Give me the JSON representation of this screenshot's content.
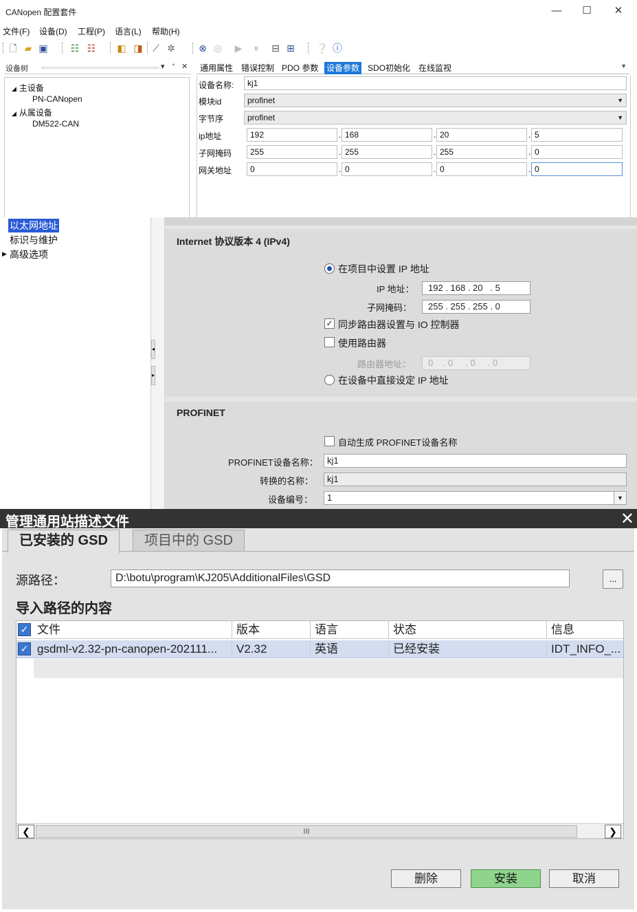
{
  "canopen": {
    "title": "CANopen 配置套件",
    "window_controls": {
      "minimize": "—",
      "maximize": "☐",
      "close": "✕"
    },
    "menu": [
      "文件(F)",
      "设备(D)",
      "工程(P)",
      "语言(L)",
      "帮助(H)"
    ],
    "device_tree": {
      "header": "设备树",
      "header_controls": [
        "▾",
        "ᐩ",
        "✕"
      ],
      "master_group": "主设备",
      "master": "PN-CANopen",
      "slave_group": "从属设备",
      "slave": "DM522-CAN"
    },
    "tabs": [
      "通用属性",
      "错误控制",
      "PDO 参数",
      "设备参数",
      "SDO初始化",
      "在线监视"
    ],
    "active_tab": "设备参数",
    "params": {
      "device_name_label": "设备名称:",
      "device_name": "kj1",
      "module_id_label": "模块id",
      "module_id": "profinet",
      "byte_order_label": "字节序",
      "byte_order": "profinet",
      "ip_label": "ip地址",
      "ip": [
        "192",
        "168",
        "20",
        "5"
      ],
      "subnet_label": "子网掩码",
      "subnet": [
        "255",
        "255",
        "255",
        "0"
      ],
      "gateway_label": "网关地址",
      "gateway": [
        "0",
        "0",
        "0",
        "0"
      ]
    }
  },
  "tia": {
    "nav": [
      "以太网地址",
      "标识与维护",
      "高级选项"
    ],
    "ipv4": {
      "title": "Internet 协议版本 4 (IPv4)",
      "set_in_project": "在项目中设置 IP 地址",
      "ip_label": "IP 地址：",
      "ip": "192 . 168 . 20   . 5",
      "subnet_label": "子网掩码：",
      "subnet": "255 . 255 . 255 . 0",
      "sync_router": "同步路由器设置与 IO 控制器",
      "use_router": "使用路由器",
      "router_label": "路由器地址：",
      "router": "0    . 0     . 0     . 0",
      "set_directly": "在设备中直接设定 IP 地址"
    },
    "profinet": {
      "title": "PROFINET",
      "auto_name": "自动生成 PROFINET设备名称",
      "name_label": "PROFINET设备名称：",
      "name": "kj1",
      "converted_label": "转换的名称：",
      "converted": "kj1",
      "number_label": "设备编号：",
      "number": "1"
    }
  },
  "gsd": {
    "title": "管理通用站描述文件",
    "close": "✕",
    "tabs": [
      "已安装的 GSD",
      "项目中的 GSD"
    ],
    "source_label": "源路径：",
    "source_path": "D:\\botu\\program\\KJ205\\AdditionalFiles\\GSD",
    "browse": "...",
    "section_title": "导入路径的内容",
    "columns": [
      "文件",
      "版本",
      "语言",
      "状态",
      "信息"
    ],
    "rows": [
      {
        "file": "gsdml-v2.32-pn-canopen-202111...",
        "version": "V2.32",
        "language": "英语",
        "status": "已经安装",
        "info": "IDT_INFO_..."
      }
    ],
    "scroll_thumb": "III",
    "buttons": {
      "delete": "删除",
      "install": "安装",
      "cancel": "取消"
    }
  }
}
